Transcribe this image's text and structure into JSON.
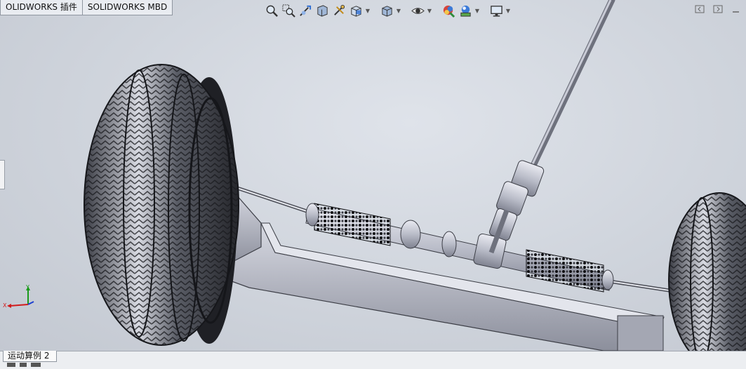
{
  "command_manager": {
    "tabs": [
      {
        "label": "OLIDWORKS 插件"
      },
      {
        "label": "SOLIDWORKS MBD"
      }
    ]
  },
  "heads_up_toolbar": {
    "buttons": [
      {
        "icon": "zoom-to-fit-icon"
      },
      {
        "icon": "zoom-to-area-icon"
      },
      {
        "icon": "previous-view-icon"
      },
      {
        "icon": "section-view-icon"
      },
      {
        "icon": "dynamic-annotation-icon"
      },
      {
        "icon": "view-orientation-icon"
      },
      {
        "icon": "display-style-icon"
      },
      {
        "icon": "hide-show-items-icon"
      },
      {
        "icon": "edit-appearance-icon"
      },
      {
        "icon": "apply-scene-icon"
      },
      {
        "icon": "view-settings-icon"
      }
    ]
  },
  "triad": {
    "x_label": "X",
    "y_label": "Y"
  },
  "motion_study": {
    "tab_label": "运动算例 2"
  },
  "colors": {
    "viewport_bg": "#cfd4dc",
    "tire_dark": "#2b2d33",
    "metal": "#b7bac6",
    "boot": "#1e1f24",
    "triad_x": "#d11b1b",
    "triad_y": "#1a9a1a",
    "triad_z": "#1b3fd1"
  }
}
